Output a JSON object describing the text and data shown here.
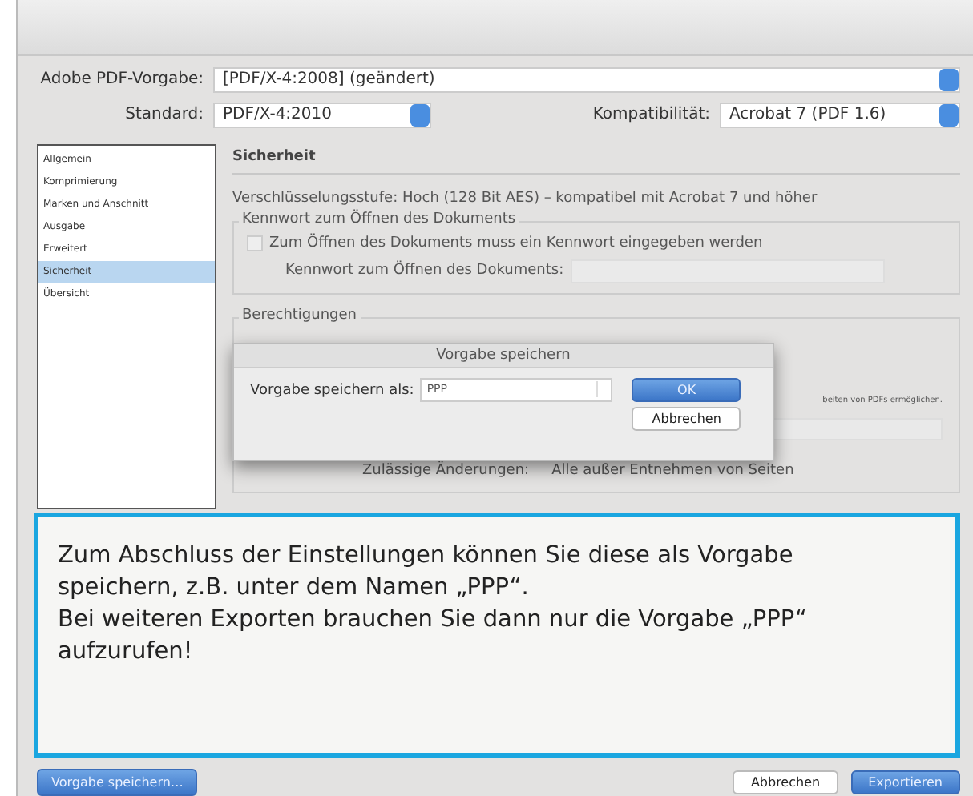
{
  "preset": {
    "label": "Adobe PDF-Vorgabe:",
    "value": "[PDF/X-4:2008] (geändert)"
  },
  "standard": {
    "label": "Standard:",
    "value": "PDF/X-4:2010"
  },
  "compatibility": {
    "label": "Kompatibilität:",
    "value": "Acrobat 7 (PDF 1.6)"
  },
  "sidebar": {
    "items": [
      {
        "label": "Allgemein",
        "selected": false
      },
      {
        "label": "Komprimierung",
        "selected": false
      },
      {
        "label": "Marken und Anschnitt",
        "selected": false
      },
      {
        "label": "Ausgabe",
        "selected": false
      },
      {
        "label": "Erweitert",
        "selected": false
      },
      {
        "label": "Sicherheit",
        "selected": true
      },
      {
        "label": "Übersicht",
        "selected": false
      }
    ]
  },
  "section_title": "Sicherheit",
  "encryption": "Verschlüsselungsstufe: Hoch (128 Bit AES) – kompatibel mit Acrobat 7 und höher",
  "open_password": {
    "legend": "Kennwort zum Öffnen des Dokuments",
    "checkbox": {
      "label": "Zum Öffnen des Dokuments muss ein Kennwort eingegeben werden",
      "checked": false
    },
    "field_label": "Kennwort zum Öffnen des Dokuments:"
  },
  "permissions": {
    "legend": "Berechtigungen",
    "note": "beiten von PDFs ermöglichen.",
    "changes_label": "Zulässige Änderungen:",
    "changes_value": "Alle außer Entnehmen von Seiten"
  },
  "dialog": {
    "title": "Vorgabe speichern",
    "label": "Vorgabe speichern als:",
    "value": "PPP",
    "buttons": [
      "OK",
      "Abbrechen"
    ]
  },
  "callout": [
    "Zum Abschluss der Einstellungen können Sie diese als Vorgabe speichern, z.B. unter dem Namen „PPP“.",
    "Bei weiteren Exporten brauchen Sie dann nur die Vorgabe „PPP“ aufzurufen!"
  ],
  "footer": {
    "save_button": "Vorgabe speichern…",
    "buttons": [
      "Abbrechen",
      "Exportieren"
    ]
  }
}
